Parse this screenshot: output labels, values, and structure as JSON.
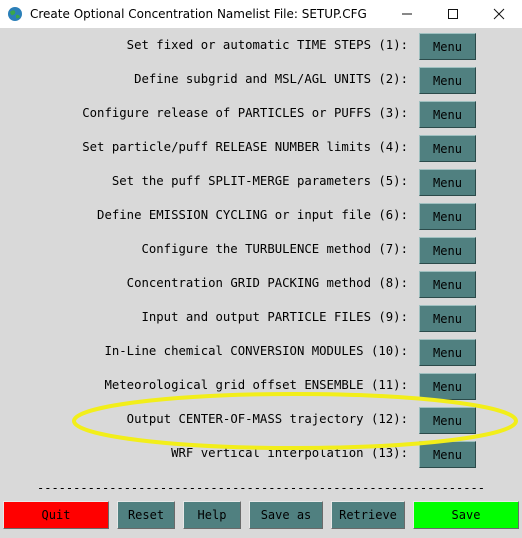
{
  "window": {
    "title": "Create Optional Concentration Namelist File: SETUP.CFG",
    "icon": "globe-app-icon",
    "minimize_glyph": "—",
    "maximize_glyph": "☐",
    "close_glyph": "✕"
  },
  "rows": [
    {
      "label": "Set fixed or automatic TIME STEPS (1):",
      "button": "Menu"
    },
    {
      "label": "Define subgrid and MSL/AGL UNITS (2):",
      "button": "Menu"
    },
    {
      "label": "Configure release of PARTICLES or PUFFS (3):",
      "button": "Menu"
    },
    {
      "label": "Set particle/puff RELEASE NUMBER limits (4):",
      "button": "Menu"
    },
    {
      "label": "Set the puff SPLIT-MERGE parameters (5):",
      "button": "Menu"
    },
    {
      "label": "Define EMISSION CYCLING or input file (6):",
      "button": "Menu"
    },
    {
      "label": "Configure the TURBULENCE method (7):",
      "button": "Menu"
    },
    {
      "label": "Concentration GRID PACKING method (8):",
      "button": "Menu"
    },
    {
      "label": "Input and output PARTICLE FILES (9):",
      "button": "Menu"
    },
    {
      "label": "In-Line chemical CONVERSION MODULES (10):",
      "button": "Menu"
    },
    {
      "label": "Meteorological grid offset ENSEMBLE (11):",
      "button": "Menu"
    },
    {
      "label": "Output CENTER-OF-MASS trajectory (12):",
      "button": "Menu"
    },
    {
      "label": "WRF vertical interpolation (13):",
      "button": "Menu"
    }
  ],
  "separator": "--------------------------------------------------------------",
  "bottom_buttons": {
    "quit": "Quit",
    "reset": "Reset",
    "help": "Help",
    "save_as": "Save as",
    "retrieve": "Retrieve",
    "save": "Save"
  },
  "colors": {
    "menu_button": "#508080",
    "quit_button": "#ff0000",
    "save_button": "#00ff00",
    "default_button": "#508080",
    "highlight": "#f2ee1a"
  }
}
